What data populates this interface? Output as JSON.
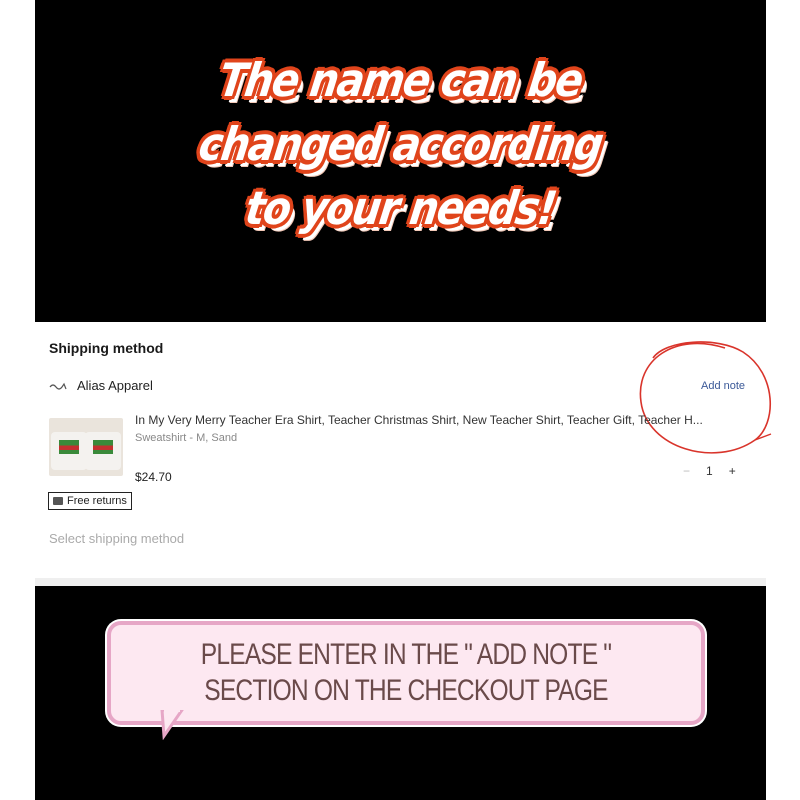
{
  "banner": {
    "line1": "The name can be",
    "line2": "changed according",
    "line3": "to your needs!"
  },
  "checkout": {
    "section_title": "Shipping method",
    "store_name": "Alias Apparel",
    "add_note_label": "Add note",
    "item_title": "In My Very Merry Teacher Era Shirt, Teacher Christmas Shirt, New Teacher Shirt, Teacher Gift, Teacher H...",
    "item_variant": "Sweatshirt - M, Sand",
    "price": "$24.70",
    "quantity": "1",
    "minus_label": "−",
    "plus_label": "+",
    "free_returns_label": "Free returns",
    "select_shipping_placeholder": "Select shipping method"
  },
  "instruction": {
    "text": "PLEASE ENTER IN THE \" ADD NOTE \" SECTION ON THE CHECKOUT PAGE"
  },
  "colors": {
    "banner_outline": "#e0441b",
    "link": "#3b5998",
    "annotation_circle": "#d9342b",
    "bubble_fill": "#fde8f1",
    "bubble_border": "#e6a6c6"
  },
  "icons": [
    "store-logo-icon",
    "box-icon",
    "shirt-thumbnail"
  ]
}
